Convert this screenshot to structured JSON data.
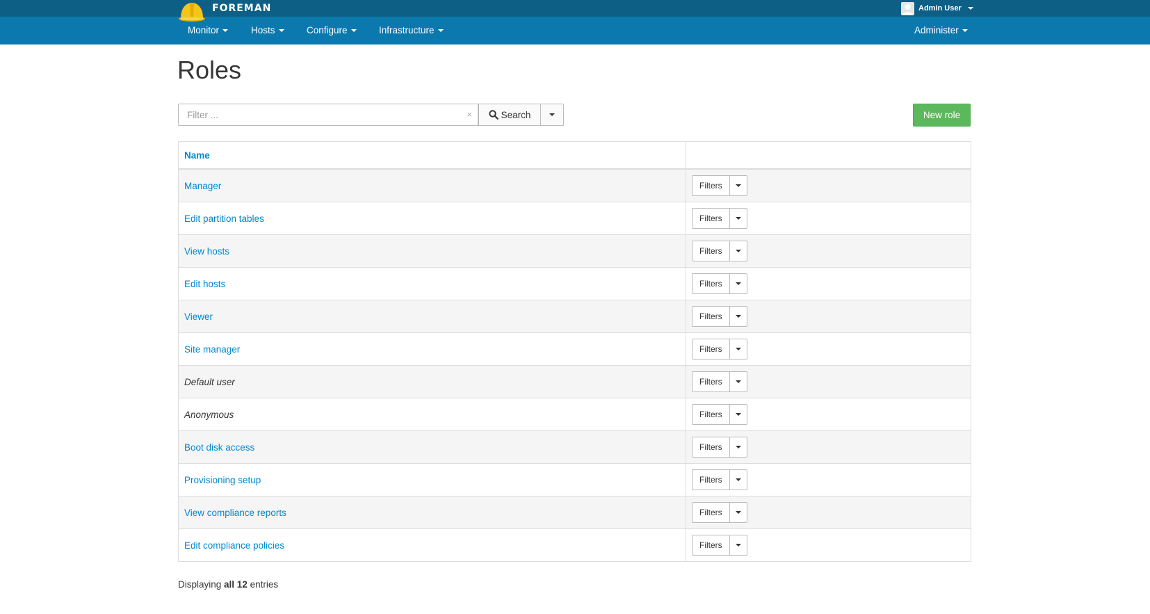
{
  "brand": "FOREMAN",
  "user": {
    "name": "Admin User"
  },
  "nav": {
    "items": [
      "Monitor",
      "Hosts",
      "Configure",
      "Infrastructure"
    ],
    "right": "Administer"
  },
  "page": {
    "title": "Roles"
  },
  "search": {
    "placeholder": "Filter ...",
    "value": "",
    "button_label": "Search"
  },
  "new_button": "New role",
  "table": {
    "headers": [
      "Name",
      ""
    ],
    "rows": [
      {
        "name": "Manager",
        "italic": false
      },
      {
        "name": "Edit partition tables",
        "italic": false
      },
      {
        "name": "View hosts",
        "italic": false
      },
      {
        "name": "Edit hosts",
        "italic": false
      },
      {
        "name": "Viewer",
        "italic": false
      },
      {
        "name": "Site manager",
        "italic": false
      },
      {
        "name": "Default user",
        "italic": true
      },
      {
        "name": "Anonymous",
        "italic": true
      },
      {
        "name": "Boot disk access",
        "italic": false
      },
      {
        "name": "Provisioning setup",
        "italic": false
      },
      {
        "name": "View compliance reports",
        "italic": false
      },
      {
        "name": "Edit compliance policies",
        "italic": false
      }
    ],
    "action_label": "Filters"
  },
  "footer": {
    "prefix": "Displaying",
    "count": "all 12",
    "suffix": "entries"
  },
  "colors": {
    "topbar": "#0e5f86",
    "navbar": "#0b79ae",
    "link": "#0088ce",
    "success": "#5cb85c"
  }
}
